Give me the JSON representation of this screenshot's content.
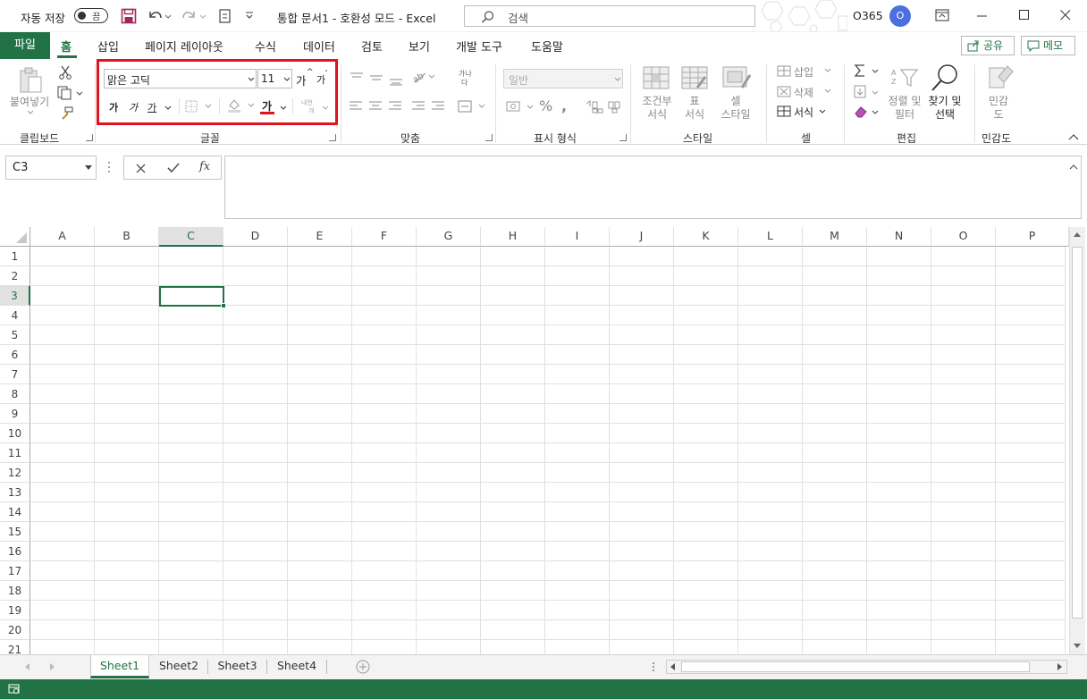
{
  "title_bar": {
    "autosave_label": "자동 저장",
    "autosave_state": "끔",
    "document_title": "통합 문서1  -  호환성 모드  -  Excel",
    "search_placeholder": "검색",
    "account_label": "O365",
    "avatar_initial": "O"
  },
  "menu": {
    "file_tab": "파일",
    "tabs": [
      "홈",
      "삽입",
      "페이지 레이아웃",
      "수식",
      "데이터",
      "검토",
      "보기",
      "개발 도구",
      "도움말"
    ],
    "active_tab": "홈",
    "share_button": "공유",
    "comments_button": "메모"
  },
  "ribbon": {
    "clipboard": {
      "group_label": "클립보드",
      "paste_label": "붙여넣기"
    },
    "font": {
      "group_label": "글꼴",
      "font_name": "맑은 고딕",
      "font_size": "11",
      "grow_label": "가",
      "shrink_label": "가",
      "bold_label": "가",
      "italic_label": "가",
      "underline_label": "가",
      "font_color_label": "가",
      "phonetic_label_top": "내천",
      "phonetic_label_bottom": "개",
      "font_color": "#e0141e"
    },
    "alignment": {
      "group_label": "맞춤",
      "wrap_label_top": "가나",
      "wrap_label_bottom": "다"
    },
    "number": {
      "group_label": "표시 형식",
      "format_value": "일반"
    },
    "styles": {
      "group_label": "스타일",
      "conditional_label": "조건부\n서식",
      "table_label": "표\n서식",
      "cell_style_label": "셀\n스타일"
    },
    "cells": {
      "group_label": "셀",
      "insert_label": "삽입",
      "delete_label": "삭제",
      "format_label": "서식"
    },
    "editing": {
      "group_label": "편집",
      "sort_label": "정렬 및\n필터",
      "find_label": "찾기 및\n선택"
    },
    "sensitivity": {
      "group_label": "민감도",
      "label": "민감\n도"
    }
  },
  "formula_bar": {
    "name_box": "C3",
    "fx_label": "fx",
    "formula": ""
  },
  "grid": {
    "columns": [
      "A",
      "B",
      "C",
      "D",
      "E",
      "F",
      "G",
      "H",
      "I",
      "J",
      "K",
      "L",
      "M",
      "N",
      "O",
      "P"
    ],
    "rows": [
      "1",
      "2",
      "3",
      "4",
      "5",
      "6",
      "7",
      "8",
      "9",
      "10",
      "11",
      "12",
      "13",
      "14",
      "15",
      "16",
      "17",
      "18",
      "19",
      "20",
      "21"
    ],
    "selected_cell": "C3"
  },
  "sheets": {
    "tabs": [
      "Sheet1",
      "Sheet2",
      "Sheet3",
      "Sheet4"
    ],
    "active": "Sheet1"
  },
  "colors": {
    "accent": "#217346",
    "highlight_box": "#e0141e",
    "avatar": "#4a70e0"
  }
}
